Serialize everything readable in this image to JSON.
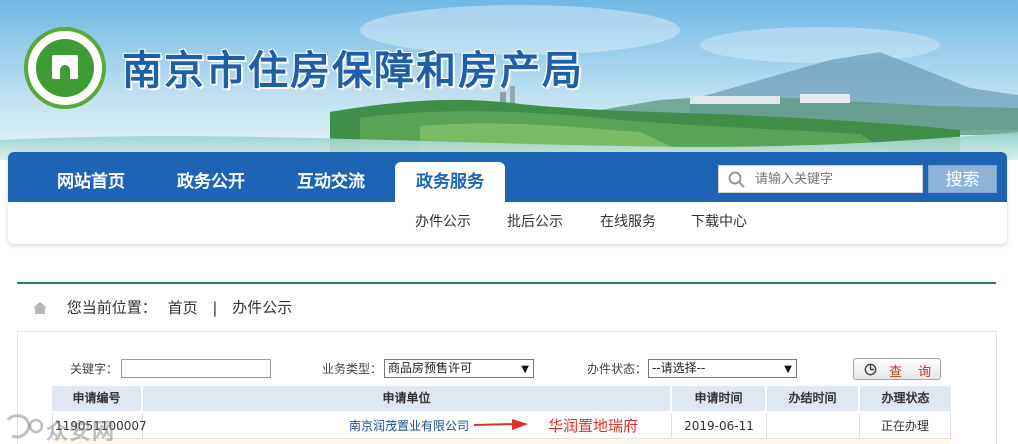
{
  "header": {
    "site_title": "南京市住房保障和房产局",
    "logo_text": "南京市住房保障和房产局"
  },
  "nav": {
    "items": [
      {
        "label": "网站首页",
        "active": false
      },
      {
        "label": "政务公开",
        "active": false
      },
      {
        "label": "互动交流",
        "active": false
      },
      {
        "label": "政务服务",
        "active": true
      }
    ],
    "search_placeholder": "请输入关键字",
    "search_button": "搜索",
    "sub_items": [
      "办件公示",
      "批后公示",
      "在线服务",
      "下载中心"
    ]
  },
  "breadcrumb": {
    "prefix": "您当前位置：",
    "home": "首页",
    "separator": "|",
    "current": "办件公示"
  },
  "filters": {
    "keyword_label": "关键字：",
    "keyword_value": "",
    "business_type_label": "业务类型：",
    "business_type_value": "商品房预售许可",
    "status_label": "办件状态：",
    "status_value": "--请选择--",
    "query_button": "查 询"
  },
  "table": {
    "headers": [
      "申请编号",
      "申请单位",
      "申请时间",
      "办结时间",
      "办理状态"
    ],
    "rows": [
      [
        "119051100007",
        "南京润茂置业有限公司",
        "2019-06-11",
        "",
        "正在办理"
      ]
    ]
  },
  "annotation": {
    "text": "华润置地瑞府",
    "color": "#e0302a"
  },
  "watermark": {
    "text": "众安网"
  },
  "colors": {
    "nav_blue": "#1e64b4",
    "title_blue": "#1f5fa8",
    "green_rule": "#2d7d4a",
    "table_header_bg": "#dfe7f2"
  },
  "icons": {
    "search": "magnifier-icon",
    "home": "home-icon",
    "query": "refresh-search-icon"
  }
}
